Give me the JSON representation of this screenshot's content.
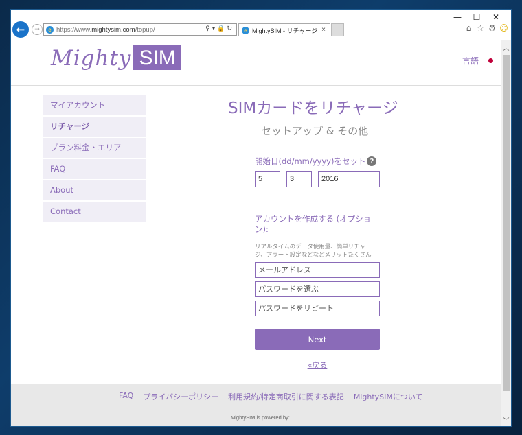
{
  "browser": {
    "url_prefix": "https://www.",
    "url_domain": "mightysim.com",
    "url_path": "/topup/",
    "tab_title": "MightySIM - リチャージ",
    "tab_close": "×",
    "win_minimize": "—",
    "win_maximize": "☐",
    "win_close": "✕"
  },
  "header": {
    "logo_mighty": "Mighty",
    "logo_sim": "SIM",
    "language_label": "言語"
  },
  "sidebar": {
    "items": [
      {
        "label": "マイアカウント"
      },
      {
        "label": "リチャージ"
      },
      {
        "label": "プラン料金・エリア"
      },
      {
        "label": "FAQ"
      },
      {
        "label": "About"
      },
      {
        "label": "Contact"
      }
    ]
  },
  "main": {
    "title": "SIMカードをリチャージ",
    "subtitle": "セットアップ & その他",
    "start_date_label": "開始日(dd/mm/yyyy)をセット",
    "help_glyph": "?",
    "day": "5",
    "month": "3",
    "year": "2016",
    "account_label": "アカウントを作成する (オプション):",
    "account_desc": "リアルタイムのデータ使用量、簡単リチャージ、アラート設定などなどメリットたくさん",
    "email_placeholder": "メールアドレス",
    "password_placeholder": "パスワードを選ぶ",
    "password_repeat_placeholder": "パスワードをリピート",
    "next_label": "Next",
    "back_label": "«戻る"
  },
  "footer": {
    "links": [
      "FAQ",
      "プライバシーポリシー",
      "利用規約/特定商取引に関する表記",
      "MightySIMについて"
    ],
    "powered_by": "MightySIM is powered by:"
  }
}
